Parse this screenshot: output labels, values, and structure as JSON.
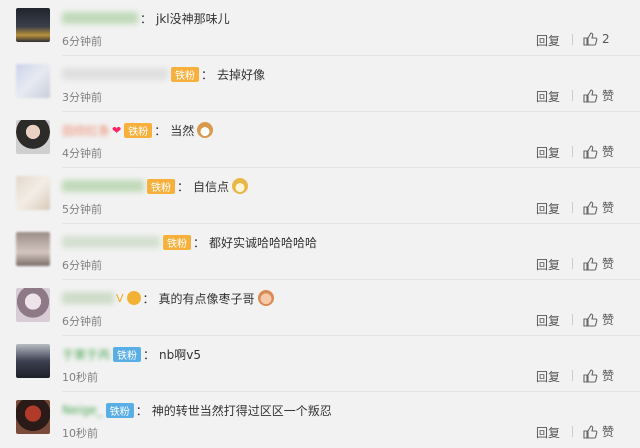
{
  "comments": [
    {
      "name": "jkl没神那味儿 user",
      "badge": "",
      "text": "jkl没神那味儿",
      "time": "6分钟前",
      "reply": "回复",
      "like": "2"
    },
    {
      "name": "blurred user 2",
      "badge": "铁粉",
      "text": "去掉好像",
      "time": "3分钟前",
      "reply": "回复",
      "like": "赞"
    },
    {
      "name": "田欣红条",
      "badge": "铁粉",
      "text": "当然",
      "time": "4分钟前",
      "reply": "回复",
      "like": "赞"
    },
    {
      "name": "blurred user 4",
      "badge": "铁粉",
      "text": "自信点",
      "time": "5分钟前",
      "reply": "回复",
      "like": "赞"
    },
    {
      "name": "blurred user 5",
      "badge": "铁粉",
      "text": "都好实诚哈哈哈哈哈",
      "time": "6分钟前",
      "reply": "回复",
      "like": "赞"
    },
    {
      "name": "blurred user 6",
      "badge": "",
      "text": "真的有点像枣子哥",
      "time": "6分钟前",
      "reply": "回复",
      "like": "赞"
    },
    {
      "name": "于茉于丙",
      "badge": "铁粉",
      "text": "nb啊v5",
      "time": "10秒前",
      "reply": "回复",
      "like": "赞"
    },
    {
      "name": "Neige_",
      "badge": "铁粉",
      "text": "神的转世当然打得过区区一个叛忍",
      "time": "10秒前",
      "reply": "回复",
      "like": "赞"
    }
  ],
  "colors": {
    "badge_gold": "#f7b03c",
    "badge_blue": "#5aaee6",
    "name_orange": "#eb7350",
    "background": "#f2f2f2"
  }
}
